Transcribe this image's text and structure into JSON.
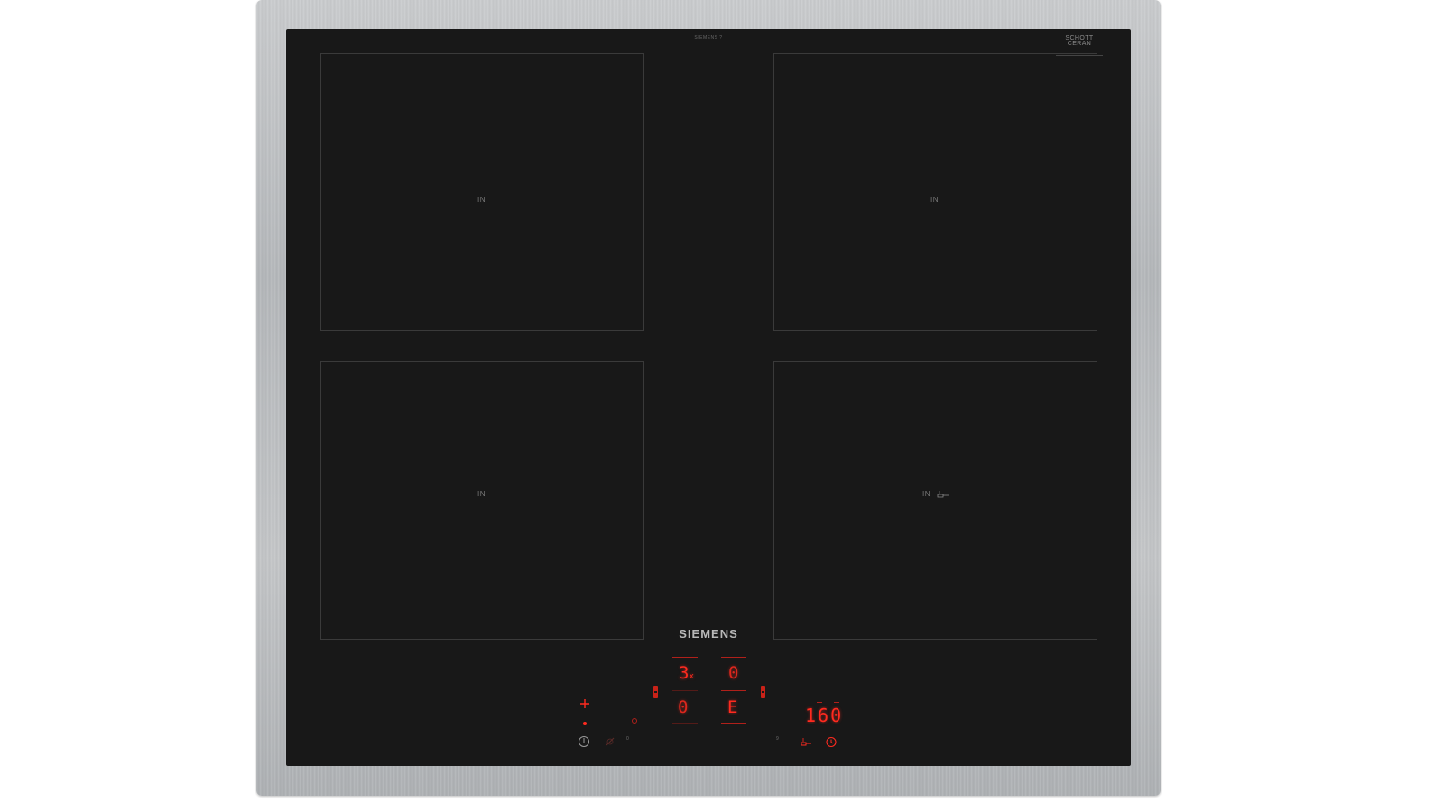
{
  "hob": {
    "top_marking": "SIEMENS ?",
    "schott_ceran": "SCHOTT\nCERAN",
    "brand": "SIEMENS"
  },
  "zones": [
    {
      "label": "IN",
      "has_pan_icon": false
    },
    {
      "label": "IN",
      "has_pan_icon": false
    },
    {
      "label": "IN",
      "has_pan_icon": false
    },
    {
      "label": "IN",
      "has_pan_icon": true
    }
  ],
  "control_panel": {
    "display_top_left": "3",
    "display_top_left_suffix": "x",
    "display_top_right": "0",
    "display_bottom_left": "0",
    "display_bottom_right": "E",
    "timer_display": "160",
    "slider_min": "0",
    "slider_max": "9",
    "icons": [
      "power-icon",
      "lock-icon",
      "frying-sensor-icon",
      "timer-icon",
      "boost-icon"
    ],
    "accent_color": "#ff2a1f"
  }
}
